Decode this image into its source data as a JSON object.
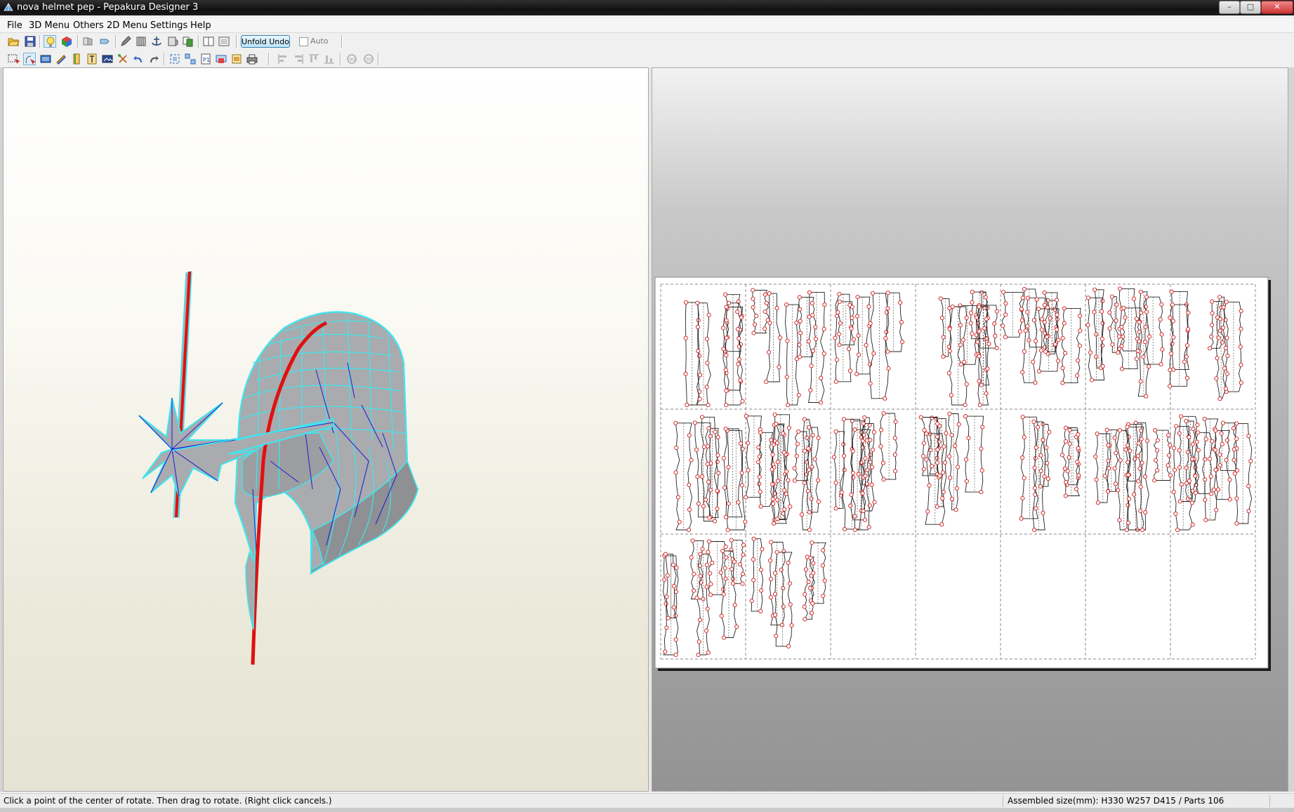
{
  "window": {
    "title": "nova helmet pep - Pepakura Designer 3",
    "controls": {
      "minimize": "–",
      "maximize": "□",
      "close": "✕"
    }
  },
  "menu": [
    "File",
    "3D Menu",
    "Others",
    "2D Menu",
    "Settings",
    "Help"
  ],
  "toolbar1": {
    "icons": [
      "open-icon",
      "save-icon",
      "light-bulb-icon",
      "texture-cube-icon",
      "unfold-icon",
      "refresh-icon",
      "pencil-icon",
      "join-icon",
      "anchor-icon",
      "flap-icon",
      "layout-icon",
      "single-pane-icon",
      "double-pane-icon"
    ],
    "unfold_undo_label": "Unfold Undo",
    "auto_label": "Auto",
    "auto_checked": false
  },
  "toolbar2": {
    "icons": [
      "select-icon",
      "rotate-icon",
      "move-icon",
      "pen-icon",
      "flap-toggle-icon",
      "text-icon",
      "image-icon",
      "split-icon",
      "undo-arrow-icon",
      "redo-arrow-icon",
      "fit-icon",
      "arrange-icon",
      "page-icon",
      "print-area-icon",
      "settings-print-icon",
      "printer-icon",
      "align-left-icon",
      "align-center-icon",
      "align-top-icon",
      "align-bottom-icon",
      "rotate-ccw-icon",
      "rotate-cw-icon"
    ]
  },
  "colors": {
    "edge_cyan": "#3fe6f0",
    "fold_blue": "#1a1ad8",
    "seam_red": "#e01010",
    "model_gray": "#a9abae",
    "part_outline": "#d01818"
  },
  "sheet": {
    "grid_columns": 7,
    "grid_rows": 3,
    "pages_with_parts": 16
  },
  "status": {
    "left": "Click a point of the center of rotate. Then drag to rotate. (Right click cancels.)",
    "right": "Assembled size(mm): H330 W257 D415 / Parts 106"
  }
}
